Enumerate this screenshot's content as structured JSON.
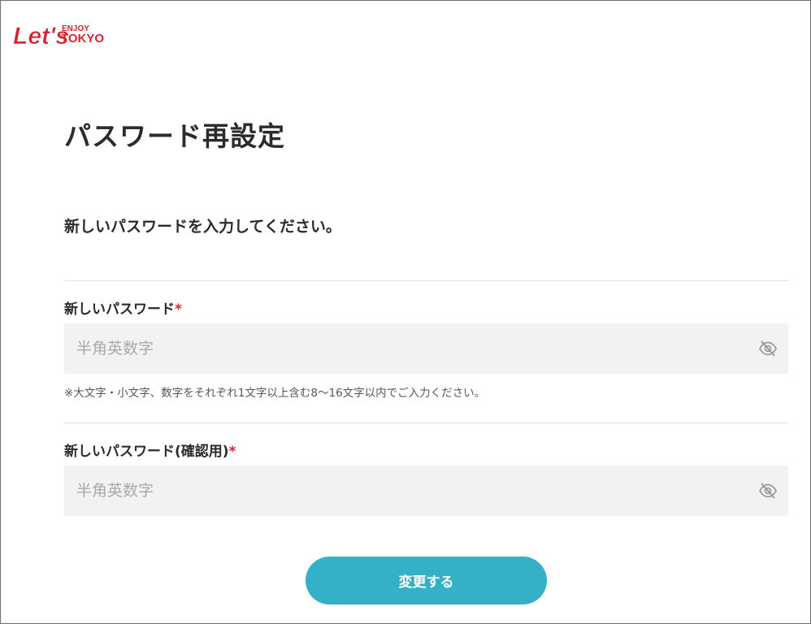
{
  "brand": {
    "logo_main": "Let's",
    "logo_top": "ENJOY",
    "logo_bottom": "TOKYO",
    "logo_color": "#d9232e"
  },
  "page": {
    "title": "パスワード再設定",
    "instruction": "新しいパスワードを入力してください。"
  },
  "fields": {
    "new_password": {
      "label": "新しいパスワード",
      "required_mark": "*",
      "placeholder": "半角英数字",
      "value": "",
      "toggle_icon": "eye-slash-icon"
    },
    "hint": "※大文字・小文字、数字をそれぞれ1文字以上含む8～16文字以内でご入力ください。",
    "confirm_password": {
      "label": "新しいパスワード(確認用)",
      "required_mark": "*",
      "placeholder": "半角英数字",
      "value": "",
      "toggle_icon": "eye-slash-icon"
    }
  },
  "actions": {
    "submit_label": "変更する"
  },
  "colors": {
    "accent": "#34b1c6",
    "required": "#d0263a",
    "input_bg": "#f2f2f2",
    "text": "#2b2b2b"
  }
}
